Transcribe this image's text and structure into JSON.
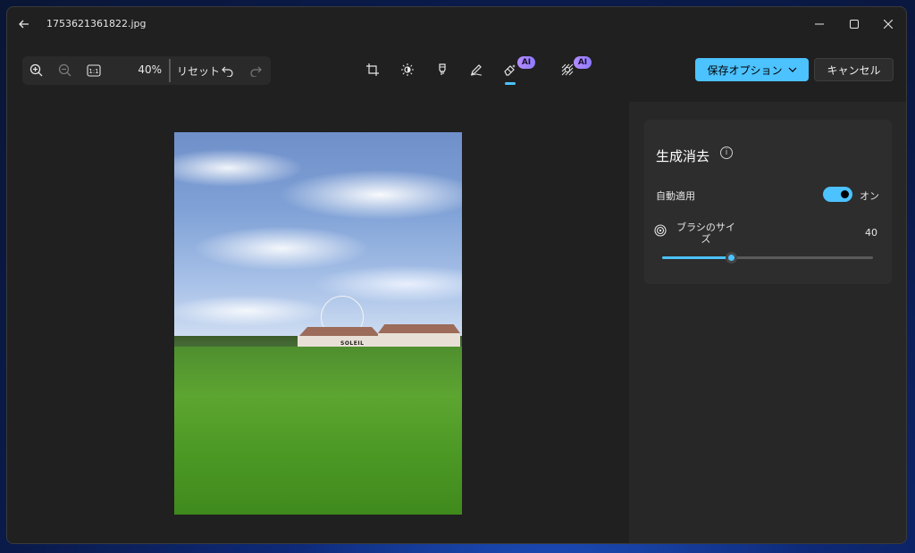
{
  "window": {
    "title": "1753621361822.jpg"
  },
  "toolbar": {
    "zoom_percent": "40%",
    "reset_label": "リセット",
    "ai_badge_label": "AI",
    "save_label": "保存オプション",
    "cancel_label": "キャンセル",
    "tools": [
      "crop-icon",
      "brightness-icon",
      "marker-icon",
      "draw-icon",
      "generative-erase-icon",
      "background-blur-icon"
    ]
  },
  "photo": {
    "sign_text": "SOLEIL"
  },
  "panel": {
    "title": "生成消去",
    "auto_apply_label": "自動適用",
    "auto_apply_state": "オン",
    "auto_apply_on": true,
    "brush_size_label": "ブラシのサイズ",
    "brush_size_value": "40",
    "brush_size_fraction": 0.33
  },
  "colors": {
    "accent": "#4cc2ff",
    "ai_badge": "#b58cff",
    "panel_bg": "#272727",
    "window_bg": "#202020"
  }
}
